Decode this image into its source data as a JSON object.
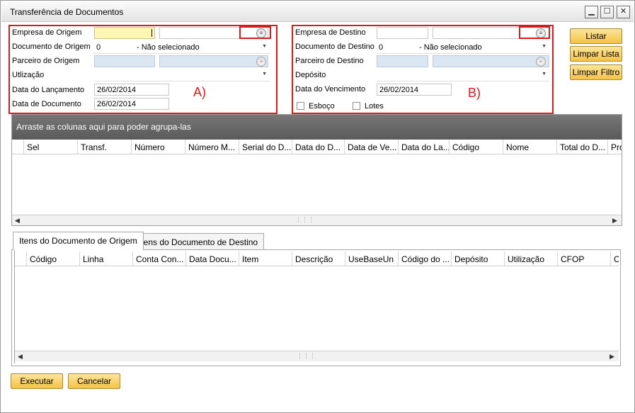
{
  "window": {
    "title": "Transferência de Documentos",
    "min_icon": "minimize-icon",
    "max_icon": "maximize-icon",
    "close_icon": "close-icon"
  },
  "origin": {
    "empresa_label": "Empresa de Origem",
    "empresa_code": "",
    "empresa_name": "",
    "documento_label": "Documento de Origem",
    "documento_value": "0",
    "documento_text": "- Não selecionado",
    "parceiro_label": "Parceiro de Origem",
    "utilizacao_label": "Utlização",
    "lancamento_label": "Data do Lançamento",
    "lancamento_value": "26/02/2014",
    "documento_data_label": "Data de Documento",
    "documento_data_value": "26/02/2014",
    "annotation": "A)"
  },
  "destination": {
    "empresa_label": "Empresa de Destino",
    "documento_label": "Documento de Destino",
    "documento_value": "0",
    "documento_text": "- Não selecionado",
    "parceiro_label": "Parceiro de Destino",
    "deposito_label": "Depósito",
    "vencimento_label": "Data do Vencimento",
    "vencimento_value": "26/02/2014",
    "esboco_label": "Esboço",
    "lotes_label": "Lotes",
    "annotation": "B)"
  },
  "side_buttons": {
    "listar": "Listar",
    "limpar_lista": "Limpar Lista",
    "limpar_filtro": "Limpar Filtro"
  },
  "main_grid": {
    "group_hint": "Arraste as colunas aqui para poder agrupa-las",
    "columns": [
      "Sel",
      "Transf.",
      "Número",
      "Número M...",
      "Serial do D...",
      "Data do D...",
      "Data de Ve...",
      "Data do La...",
      "Código",
      "Nome",
      "Total do D...",
      "Pro"
    ]
  },
  "tabs": {
    "origem": "Itens do Documento de Origem",
    "destino": "Itens do Documento de Destino"
  },
  "items_grid": {
    "columns": [
      "Código",
      "Linha",
      "Conta Con...",
      "Data Docu...",
      "Item",
      "Descrição",
      "UseBaseUn",
      "Código do ...",
      "Depósito",
      "Utilização",
      "CFOP",
      "C:"
    ]
  },
  "footer": {
    "executar": "Executar",
    "cancelar": "Cancelar"
  },
  "colors": {
    "annotation_red": "#d61c1c",
    "button_gold": "#f5c344",
    "field_yellow": "#fff6b4",
    "field_blue": "#dbe6f3"
  }
}
